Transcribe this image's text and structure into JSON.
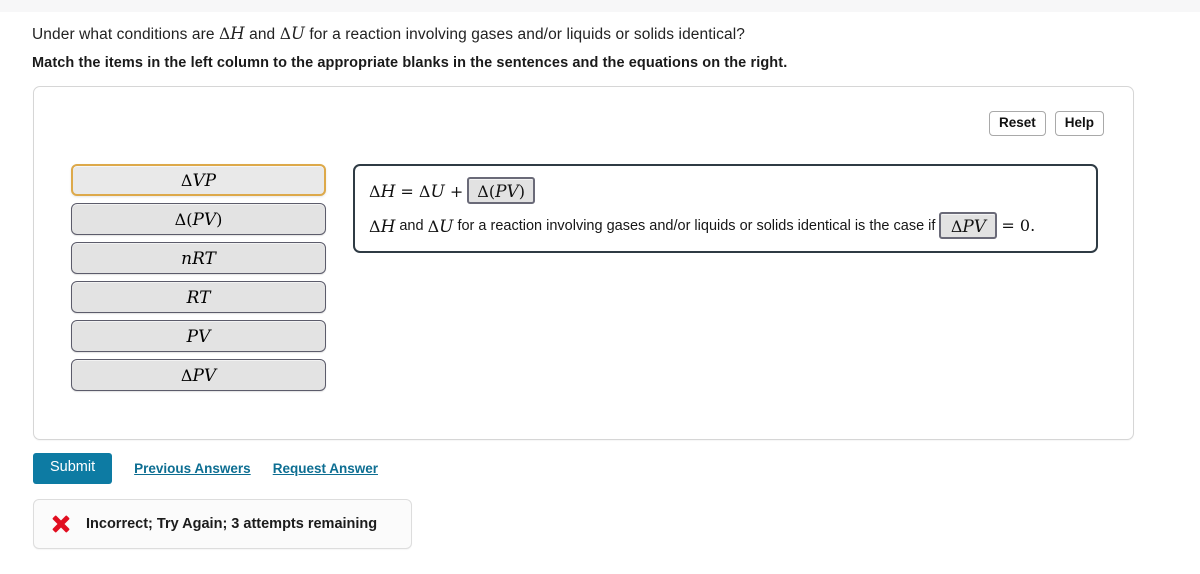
{
  "question": {
    "prompt_pre": "Under what conditions are ",
    "prompt_sym1": "ΔH",
    "prompt_mid": " and ",
    "prompt_sym2": "ΔU",
    "prompt_post": " for a reaction involving gases and/or liquids or solids identical?",
    "full_prompt": "Under what conditions are ΔH and ΔU for a reaction involving gases and/or liquids or solids identical?",
    "instruction": "Match the items in the left column to the appropriate blanks in the sentences and the equations on the right."
  },
  "toolbar": {
    "reset_label": "Reset",
    "help_label": "Help"
  },
  "bank": {
    "items": [
      {
        "label": "ΔVP",
        "selected": true
      },
      {
        "label": "Δ(PV)",
        "selected": false
      },
      {
        "label": "nRT",
        "selected": false
      },
      {
        "label": "RT",
        "selected": false
      },
      {
        "label": "PV",
        "selected": false
      },
      {
        "label": "ΔPV",
        "selected": false
      }
    ]
  },
  "answer_panel": {
    "line1": {
      "lhs": "ΔH = ΔU +",
      "blank_value": "Δ(PV)"
    },
    "line2": {
      "text_before": "ΔH and ΔU for a reaction involving gases and/or liquids or solids identical is the case if",
      "blank_value": "ΔPV",
      "text_after": "= 0."
    }
  },
  "actions": {
    "submit_label": "Submit",
    "previous_answers_label": "Previous Answers",
    "request_answer_label": "Request Answer"
  },
  "feedback": {
    "icon": "x-mark-icon",
    "message": "Incorrect; Try Again; 3 attempts remaining"
  },
  "colors": {
    "submit_blue": "#0d7ba3",
    "link_blue": "#0d6e92",
    "selected_border_orange": "#dda94a",
    "item_border_slate": "#5c5c6b",
    "panel_border_dark": "#2f3b44",
    "error_red": "#e10e20"
  }
}
